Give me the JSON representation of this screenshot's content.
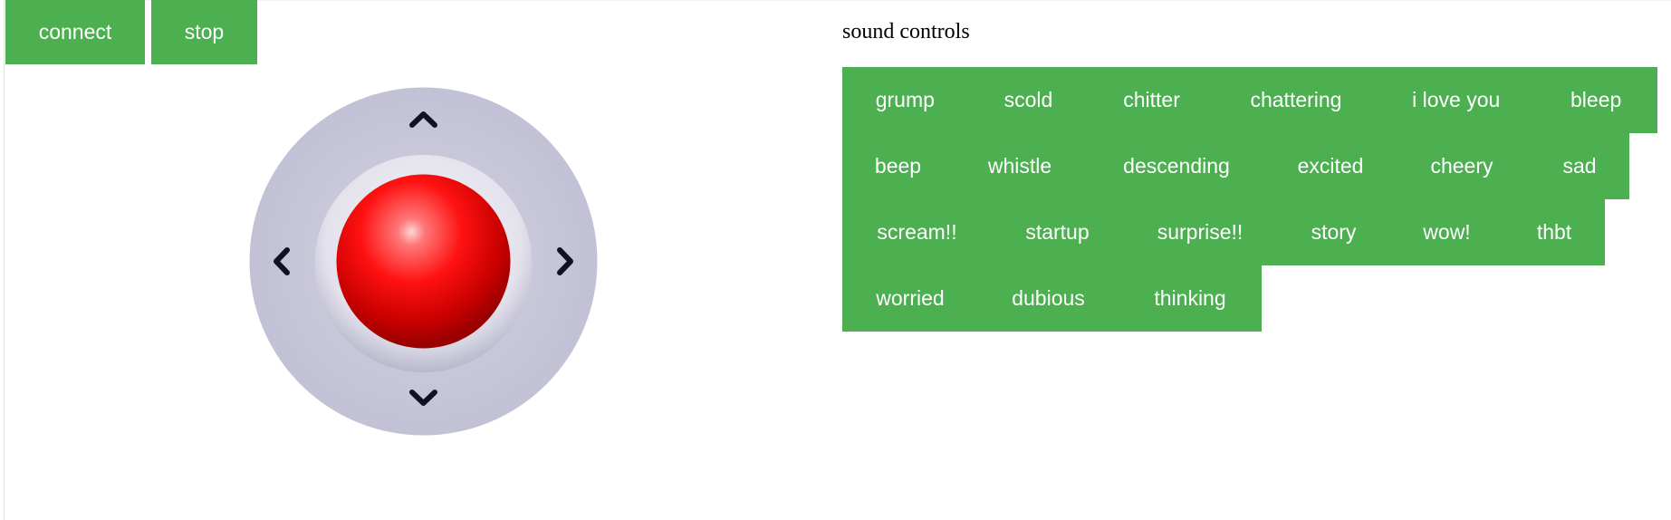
{
  "toolbar": {
    "connect_label": "connect",
    "stop_label": "stop"
  },
  "joystick": {
    "up_icon": "chevron-up-icon",
    "down_icon": "chevron-down-icon",
    "left_icon": "chevron-left-icon",
    "right_icon": "chevron-right-icon",
    "knob_color": "#ff0000",
    "base_color": "#c7c6d9"
  },
  "sound_controls": {
    "title": "sound controls",
    "rows": [
      [
        "grump",
        "scold",
        "chitter",
        "chattering",
        "i love you",
        "bleep"
      ],
      [
        "beep",
        "whistle",
        "descending",
        "excited",
        "cheery",
        "sad"
      ],
      [
        "scream!!",
        "startup",
        "surprise!!",
        "story",
        "wow!",
        "thbt"
      ],
      [
        "worried",
        "dubious",
        "thinking"
      ]
    ]
  },
  "colors": {
    "button_bg": "#4caf50",
    "button_text": "#ffffff"
  }
}
